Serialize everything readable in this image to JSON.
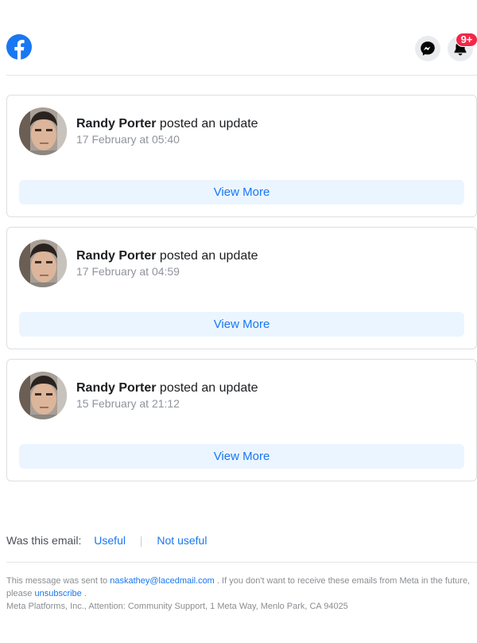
{
  "header": {
    "logo_icon": "facebook-logo-icon",
    "messenger_icon": "messenger-icon",
    "notification_icon": "bell-icon",
    "notification_badge": "9+",
    "brand_color": "#1877f2",
    "badge_color": "#f02849"
  },
  "posts": [
    {
      "author": "Randy Porter",
      "action": " posted an update",
      "date": "17 February at 05:40",
      "button": "View More"
    },
    {
      "author": "Randy Porter",
      "action": " posted an update",
      "date": "17 February at 04:59",
      "button": "View More"
    },
    {
      "author": "Randy Porter",
      "action": " posted an update",
      "date": "15 February at 21:12",
      "button": "View More"
    }
  ],
  "feedback": {
    "question": "Was this email:",
    "useful": "Useful",
    "separator": "|",
    "not_useful": "Not useful"
  },
  "footer": {
    "sent_prefix": "This message was sent to ",
    "email": "naskathey@lacedmail.com",
    "sent_suffix": " . If you don't want to receive these emails from Meta in the future, please ",
    "unsubscribe": "unsubscribe",
    "period": " .",
    "address": "Meta Platforms, Inc., Attention: Community Support, 1 Meta Way, Menlo Park, CA 94025"
  }
}
